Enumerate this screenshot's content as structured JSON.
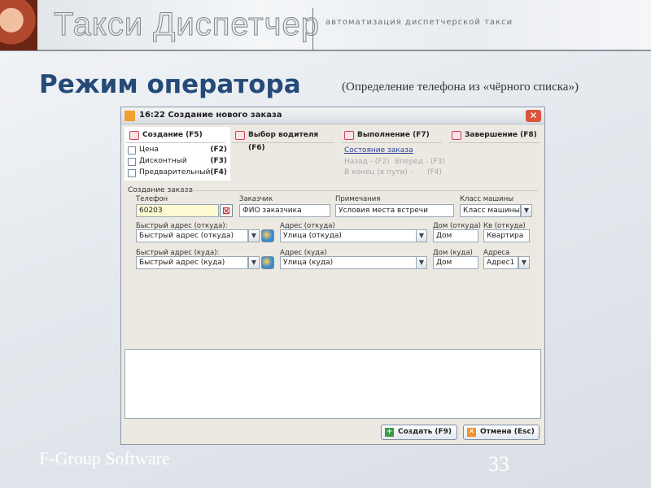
{
  "header": {
    "app_title": "Такси Диспетчер",
    "app_subtitle": "автоматизация диспетчерской такси"
  },
  "slide": {
    "title": "Режим оператора",
    "subtitle": "(Определение телефона из «чёрного списка»)",
    "footer": "F-Group Software",
    "page_number": "33"
  },
  "dialog": {
    "title": "16:22 Создание нового заказа",
    "tabs": [
      {
        "label": "Создание (F5)"
      },
      {
        "label": "Выбор водителя (F6)"
      },
      {
        "label": "Выполнение (F7)"
      },
      {
        "label": "Завершение (F8)"
      }
    ],
    "options": [
      {
        "label": "Цена",
        "key": "(F2)"
      },
      {
        "label": "Дисконтный",
        "key": "(F3)"
      },
      {
        "label": "Предварительный",
        "key": "(F4)"
      }
    ],
    "status": {
      "link": "Состояние заказа",
      "back": "Назад - (F2)",
      "forward": "Вперед - (F3)",
      "end": "В конец (в пути) -",
      "end_key": "(F4)"
    },
    "group_label": "Создание заказа",
    "fields": {
      "phone": {
        "label": "Телефон",
        "value": "60203"
      },
      "customer": {
        "label": "Заказчик",
        "value": "ФИО заказчика"
      },
      "notes": {
        "label": "Примечания",
        "value": "Условия места встречи"
      },
      "car_class": {
        "label": "Класс машины",
        "value": "Класс машины"
      },
      "quick_from": {
        "label": "Быстрый адрес (откуда):",
        "value": "Быстрый адрес (откуда)"
      },
      "addr_from": {
        "label": "Адрес (откуда)",
        "value": "Улица (откуда)"
      },
      "house_from": {
        "label": "Дом (откуда)",
        "value": "Дом"
      },
      "apt_from": {
        "label": "Кв (откуда)",
        "value": "Квартира"
      },
      "quick_to": {
        "label": "Быстрый адрес (куда):",
        "value": "Быстрый адрес (куда)"
      },
      "addr_to": {
        "label": "Адрес (куда)",
        "value": "Улица (куда)"
      },
      "house_to": {
        "label": "Дом (куда)",
        "value": "Дом"
      },
      "addresses": {
        "label": "Адреса",
        "value": "Адрес1"
      }
    },
    "buttons": {
      "create": "Создать (F9)",
      "cancel": "Отмена (Esc)"
    }
  }
}
